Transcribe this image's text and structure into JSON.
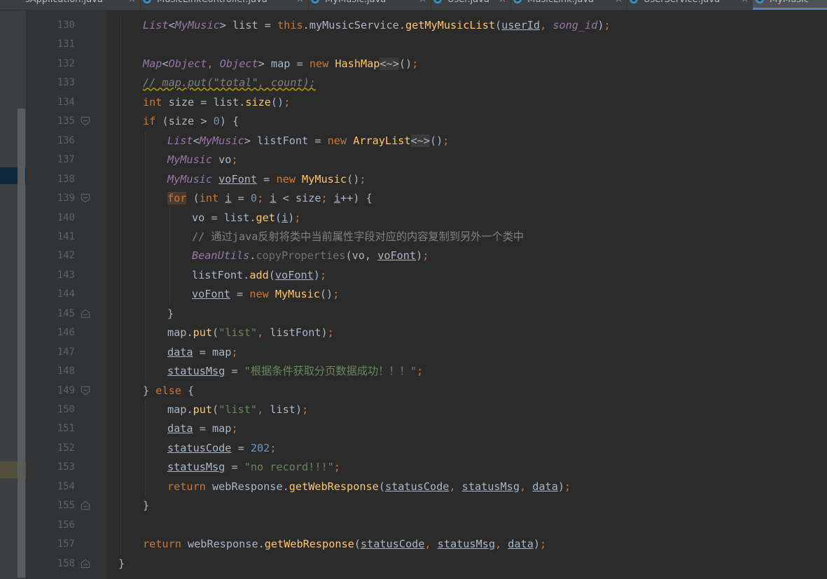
{
  "tabs": [
    {
      "label": "sApplication.java",
      "active": false
    },
    {
      "label": "MusicLinkController.java",
      "active": false
    },
    {
      "label": "MyMusic.java",
      "active": false
    },
    {
      "label": "User.java",
      "active": false
    },
    {
      "label": "MusicLink.java",
      "active": false
    },
    {
      "label": "UserService.java",
      "active": false
    },
    {
      "label": "MyMusic",
      "active": true
    }
  ],
  "tab_close_glyph": "×",
  "lines": [
    {
      "n": 130,
      "indent": 2,
      "tokens": [
        [
          "List",
          "cls"
        ],
        [
          "<",
          "op"
        ],
        [
          "MyMusic",
          "cls"
        ],
        [
          "> list ",
          "op"
        ],
        [
          "= ",
          "op"
        ],
        [
          "this",
          "kw"
        ],
        [
          ".",
          "op"
        ],
        [
          "myMusicService",
          "plain"
        ],
        [
          ".",
          "op"
        ],
        [
          "getMyMusicList",
          "method"
        ],
        [
          "(",
          "op"
        ],
        [
          "userId",
          "ul"
        ],
        [
          ", ",
          "kw"
        ],
        [
          "song_id",
          "it"
        ],
        [
          ")",
          "op"
        ],
        [
          ";",
          "kw"
        ]
      ]
    },
    {
      "n": 131,
      "indent": 0,
      "tokens": []
    },
    {
      "n": 132,
      "indent": 2,
      "tokens": [
        [
          "Map",
          "cls"
        ],
        [
          "<",
          "op"
        ],
        [
          "Object",
          "it"
        ],
        [
          ", ",
          "kw"
        ],
        [
          "Object",
          "it"
        ],
        [
          "> map ",
          "op"
        ],
        [
          "= ",
          "op"
        ],
        [
          "new ",
          "kw"
        ],
        [
          "HashMap",
          "method"
        ],
        [
          "<~>",
          "chip"
        ],
        [
          "()",
          "op"
        ],
        [
          ";",
          "kw"
        ]
      ]
    },
    {
      "n": 133,
      "indent": 2,
      "tokens": [
        [
          "// map.put(\"total\", count);",
          "wavy"
        ]
      ]
    },
    {
      "n": 134,
      "indent": 2,
      "tokens": [
        [
          "int ",
          "kw"
        ],
        [
          "size ",
          "plain"
        ],
        [
          "= ",
          "op"
        ],
        [
          "list",
          "plain"
        ],
        [
          ".",
          "op"
        ],
        [
          "size",
          "method"
        ],
        [
          "()",
          "op"
        ],
        [
          ";",
          "kw"
        ]
      ]
    },
    {
      "n": 135,
      "indent": 2,
      "tokens": [
        [
          "if ",
          "kw"
        ],
        [
          "(size ",
          "plain"
        ],
        [
          "> ",
          "op"
        ],
        [
          "0",
          "num"
        ],
        [
          ") {",
          "plain"
        ]
      ]
    },
    {
      "n": 136,
      "indent": 3,
      "tokens": [
        [
          "List",
          "cls"
        ],
        [
          "<",
          "op"
        ],
        [
          "MyMusic",
          "cls"
        ],
        [
          "> listFont ",
          "op"
        ],
        [
          "= ",
          "op"
        ],
        [
          "new ",
          "kw"
        ],
        [
          "ArrayList",
          "method"
        ],
        [
          "<~>",
          "chip"
        ],
        [
          "()",
          "op"
        ],
        [
          ";",
          "kw"
        ]
      ]
    },
    {
      "n": 137,
      "indent": 3,
      "tokens": [
        [
          "MyMusic ",
          "cls"
        ],
        [
          "vo",
          "plain"
        ],
        [
          ";",
          "kw"
        ]
      ]
    },
    {
      "n": 138,
      "indent": 3,
      "tokens": [
        [
          "MyMusic ",
          "cls"
        ],
        [
          "voFont",
          "ul"
        ],
        [
          " = ",
          "op"
        ],
        [
          "new ",
          "kw"
        ],
        [
          "MyMusic",
          "method"
        ],
        [
          "()",
          "op"
        ],
        [
          ";",
          "kw"
        ]
      ]
    },
    {
      "n": 139,
      "indent": 3,
      "tokens": [
        [
          "for",
          "for"
        ],
        [
          " (",
          "plain"
        ],
        [
          "int ",
          "kw"
        ],
        [
          "i",
          "ul"
        ],
        [
          " = ",
          "op"
        ],
        [
          "0",
          "num"
        ],
        [
          "; ",
          "kw"
        ],
        [
          "i",
          "ul"
        ],
        [
          " < ",
          "op"
        ],
        [
          "size",
          "plain"
        ],
        [
          "; ",
          "kw"
        ],
        [
          "i",
          "ul"
        ],
        [
          "++",
          "op"
        ],
        [
          ") {",
          "plain"
        ]
      ]
    },
    {
      "n": 140,
      "indent": 4,
      "tokens": [
        [
          "vo ",
          "plain"
        ],
        [
          "= ",
          "op"
        ],
        [
          "list",
          "plain"
        ],
        [
          ".",
          "op"
        ],
        [
          "get",
          "method"
        ],
        [
          "(",
          "op"
        ],
        [
          "i",
          "ul"
        ],
        [
          ")",
          "op"
        ],
        [
          ";",
          "kw"
        ]
      ]
    },
    {
      "n": 141,
      "indent": 4,
      "tokens": [
        [
          "// 通过java反射将类中当前属性字段对应的内容复制到另外一个类中",
          "cmt"
        ]
      ]
    },
    {
      "n": 142,
      "indent": 4,
      "tokens": [
        [
          "BeanUtils",
          "cls"
        ],
        [
          ".",
          "op"
        ],
        [
          "copyProperties",
          "dim"
        ],
        [
          "(vo, ",
          "plain"
        ],
        [
          "voFont",
          "ul"
        ],
        [
          ")",
          "op"
        ],
        [
          ";",
          "kw"
        ]
      ]
    },
    {
      "n": 143,
      "indent": 4,
      "tokens": [
        [
          "listFont",
          "plain"
        ],
        [
          ".",
          "op"
        ],
        [
          "add",
          "method"
        ],
        [
          "(",
          "op"
        ],
        [
          "voFont",
          "ul"
        ],
        [
          ")",
          "op"
        ],
        [
          ";",
          "kw"
        ]
      ]
    },
    {
      "n": 144,
      "indent": 4,
      "tokens": [
        [
          "voFont",
          "ul"
        ],
        [
          " = ",
          "op"
        ],
        [
          "new ",
          "kw"
        ],
        [
          "MyMusic",
          "method"
        ],
        [
          "()",
          "op"
        ],
        [
          ";",
          "kw"
        ]
      ]
    },
    {
      "n": 145,
      "indent": 3,
      "tokens": [
        [
          "}",
          "plain"
        ]
      ]
    },
    {
      "n": 146,
      "indent": 3,
      "tokens": [
        [
          "map",
          "plain"
        ],
        [
          ".",
          "op"
        ],
        [
          "put",
          "method"
        ],
        [
          "(",
          "op"
        ],
        [
          "\"list\"",
          "str"
        ],
        [
          ", ",
          "kw"
        ],
        [
          "listFont",
          "plain"
        ],
        [
          ")",
          "op"
        ],
        [
          ";",
          "kw"
        ]
      ]
    },
    {
      "n": 147,
      "indent": 3,
      "tokens": [
        [
          "data",
          "ul"
        ],
        [
          " = ",
          "op"
        ],
        [
          "map",
          "plain"
        ],
        [
          ";",
          "kw"
        ]
      ]
    },
    {
      "n": 148,
      "indent": 3,
      "tokens": [
        [
          "statusMsg",
          "ul"
        ],
        [
          " = ",
          "op"
        ],
        [
          "\"根据条件获取分页数据成功！！！\"",
          "str"
        ],
        [
          ";",
          "kw"
        ]
      ]
    },
    {
      "n": 149,
      "indent": 2,
      "tokens": [
        [
          "} ",
          "plain"
        ],
        [
          "else ",
          "kw"
        ],
        [
          "{",
          "plain"
        ]
      ]
    },
    {
      "n": 150,
      "indent": 3,
      "tokens": [
        [
          "map",
          "plain"
        ],
        [
          ".",
          "op"
        ],
        [
          "put",
          "method"
        ],
        [
          "(",
          "op"
        ],
        [
          "\"list\"",
          "str"
        ],
        [
          ", ",
          "kw"
        ],
        [
          "list",
          "plain"
        ],
        [
          ")",
          "op"
        ],
        [
          ";",
          "kw"
        ]
      ]
    },
    {
      "n": 151,
      "indent": 3,
      "tokens": [
        [
          "data",
          "ul"
        ],
        [
          " = ",
          "op"
        ],
        [
          "map",
          "plain"
        ],
        [
          ";",
          "kw"
        ]
      ]
    },
    {
      "n": 152,
      "indent": 3,
      "tokens": [
        [
          "statusCode",
          "ul"
        ],
        [
          " = ",
          "op"
        ],
        [
          "202",
          "num"
        ],
        [
          ";",
          "kw"
        ]
      ]
    },
    {
      "n": 153,
      "indent": 3,
      "tokens": [
        [
          "statusMsg",
          "ul"
        ],
        [
          " = ",
          "op"
        ],
        [
          "\"no record!!!\"",
          "str"
        ],
        [
          ";",
          "kw"
        ]
      ]
    },
    {
      "n": 154,
      "indent": 3,
      "tokens": [
        [
          "return ",
          "kw"
        ],
        [
          "webResponse",
          "plain"
        ],
        [
          ".",
          "op"
        ],
        [
          "getWebResponse",
          "method"
        ],
        [
          "(",
          "op"
        ],
        [
          "statusCode",
          "ul"
        ],
        [
          ", ",
          "kw"
        ],
        [
          "statusMsg",
          "ul"
        ],
        [
          ", ",
          "kw"
        ],
        [
          "data",
          "ul"
        ],
        [
          ")",
          "op"
        ],
        [
          ";",
          "kw"
        ]
      ]
    },
    {
      "n": 155,
      "indent": 2,
      "tokens": [
        [
          "}",
          "plain"
        ]
      ]
    },
    {
      "n": 156,
      "indent": 0,
      "tokens": []
    },
    {
      "n": 157,
      "indent": 2,
      "tokens": [
        [
          "return ",
          "kw"
        ],
        [
          "webResponse",
          "plain"
        ],
        [
          ".",
          "op"
        ],
        [
          "getWebResponse",
          "method"
        ],
        [
          "(",
          "op"
        ],
        [
          "statusCode",
          "ul"
        ],
        [
          ", ",
          "kw"
        ],
        [
          "statusMsg",
          "ul"
        ],
        [
          ", ",
          "kw"
        ],
        [
          "data",
          "ul"
        ],
        [
          ")",
          "op"
        ],
        [
          ";",
          "kw"
        ]
      ]
    },
    {
      "n": 158,
      "indent": 1,
      "tokens": [
        [
          "}",
          "plain"
        ]
      ]
    }
  ],
  "folds": [
    {
      "line": 135,
      "kind": "open"
    },
    {
      "line": 139,
      "kind": "open"
    },
    {
      "line": 145,
      "kind": "close"
    },
    {
      "line": 149,
      "kind": "open"
    },
    {
      "line": 155,
      "kind": "close"
    },
    {
      "line": 158,
      "kind": "close"
    }
  ],
  "colors": {
    "keyword": "#cc7832",
    "class": "#9876aa",
    "method": "#ffc66d",
    "string": "#6a8759",
    "number": "#6897bb",
    "comment": "#808080",
    "plain": "#a9b7c6",
    "background": "#2b2b2b",
    "gutter": "#313335"
  }
}
